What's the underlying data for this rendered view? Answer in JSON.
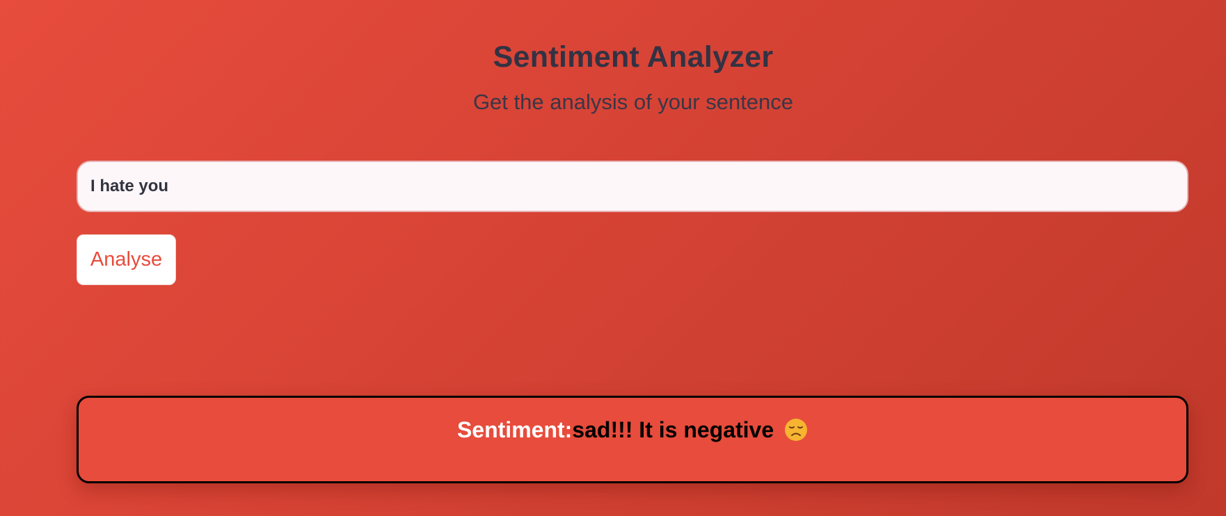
{
  "header": {
    "title": "Sentiment Analyzer",
    "subtitle": "Get the analysis of your sentence"
  },
  "input": {
    "value": "I hate you"
  },
  "actions": {
    "analyse_label": "Analyse"
  },
  "result": {
    "label": "Sentiment:",
    "value": "sad!!! It is negative",
    "emoji_icon": "disappointed-face-icon"
  },
  "colors": {
    "background": "#e74c3c",
    "accent": "#e74c3c",
    "text_dark": "#31333f"
  }
}
